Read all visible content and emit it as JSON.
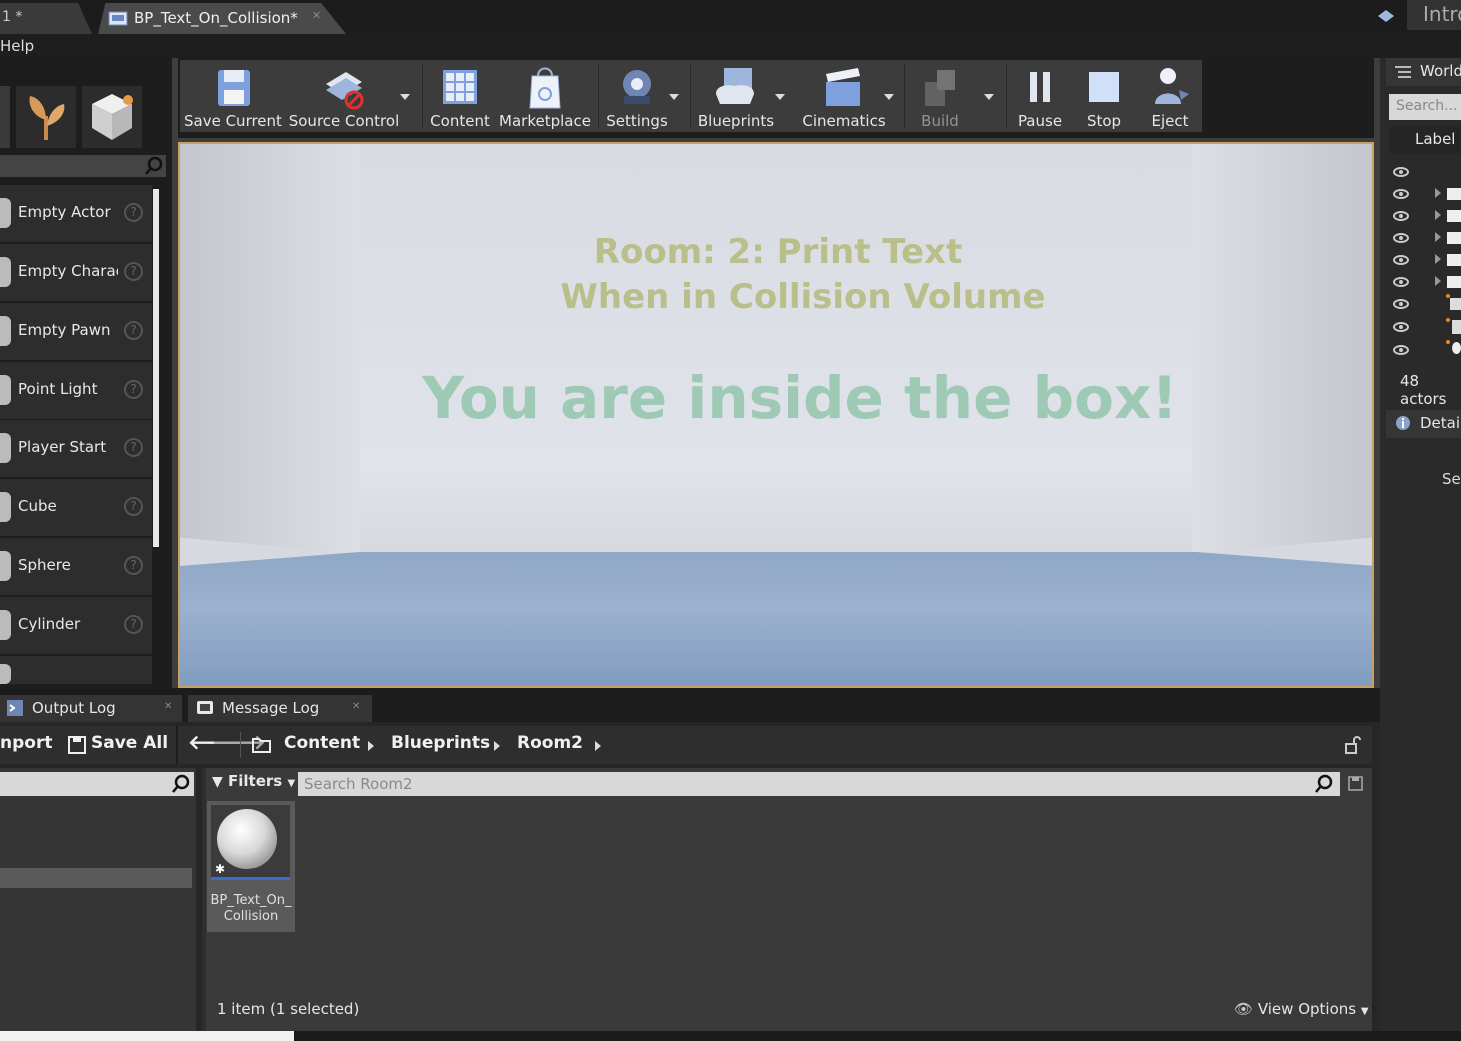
{
  "window": {
    "prev_tab_label": "1 *",
    "active_tab_label": "BP_Text_On_Collision*",
    "right_tab_label": "Intro",
    "menu_help": "Help"
  },
  "place_panel": {
    "items": [
      {
        "label": "Empty Actor"
      },
      {
        "label": "Empty Charac"
      },
      {
        "label": "Empty Pawn"
      },
      {
        "label": "Point Light"
      },
      {
        "label": "Player Start"
      },
      {
        "label": "Cube"
      },
      {
        "label": "Sphere"
      },
      {
        "label": "Cylinder"
      }
    ]
  },
  "toolbar": {
    "save_current": "Save Current",
    "source_control": "Source Control",
    "content": "Content",
    "marketplace": "Marketplace",
    "settings": "Settings",
    "blueprints": "Blueprints",
    "cinematics": "Cinematics",
    "build": "Build",
    "pause": "Pause",
    "stop": "Stop",
    "eject": "Eject"
  },
  "viewport": {
    "line1": "Room: 2: Print Text",
    "line2": "When in Collision Volume",
    "line3": "You are inside the box!",
    "colors": {
      "title_text": "#b9be8a",
      "message_text": "#9ec9b4",
      "border": "#c8a060"
    }
  },
  "world_outliner": {
    "title": "World",
    "search_placeholder": "Search...",
    "label_header": "Label",
    "actor_count": "48 actors",
    "details_title": "Detail",
    "details_hint": "Sel"
  },
  "bottom_tabs": {
    "output_log": "Output Log",
    "message_log": "Message Log"
  },
  "content_browser": {
    "import_label": "nport",
    "save_all": "Save All",
    "breadcrumbs": [
      "Content",
      "Blueprints",
      "Room2"
    ],
    "filters_label": "Filters",
    "search_placeholder": "Search Room2",
    "asset_name": "BP_Text_On_\nCollision",
    "status": "1 item (1 selected)",
    "view_options": "View Options"
  }
}
